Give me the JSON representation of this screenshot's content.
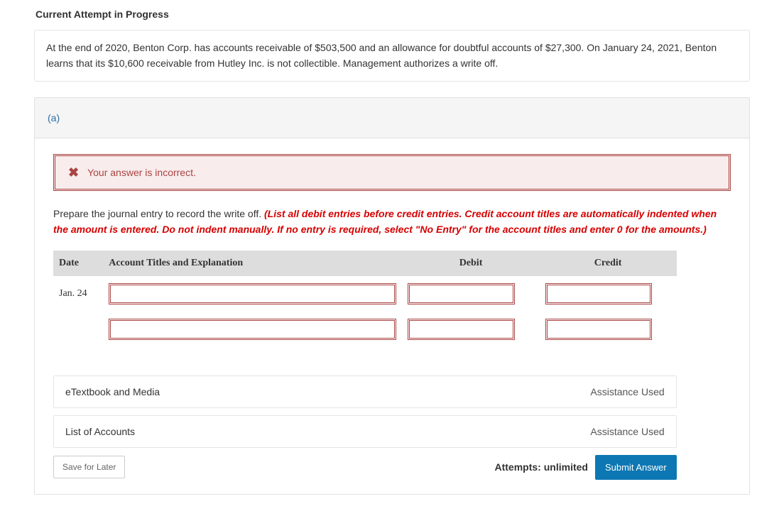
{
  "heading": "Current Attempt in Progress",
  "question_text": "At the end of 2020, Benton Corp. has accounts receivable of $503,500 and an allowance for doubtful accounts of $27,300. On January 24, 2021, Benton learns that its $10,600 receivable from Hutley Inc. is not collectible. Management authorizes a write off.",
  "part_label": "(a)",
  "alert_text": "Your answer is incorrect.",
  "instruction_plain": "Prepare the journal entry to record the write off. ",
  "instruction_red": "(List all debit entries before credit entries. Credit account titles are automatically indented when the amount is entered. Do not indent manually. If no entry is required, select \"No Entry\" for the account titles and enter 0 for the amounts.)",
  "table": {
    "headers": {
      "date": "Date",
      "acct": "Account Titles and Explanation",
      "debit": "Debit",
      "credit": "Credit"
    },
    "rows": [
      {
        "date": "Jan. 24",
        "acct": "",
        "debit": "",
        "credit": ""
      },
      {
        "date": "",
        "acct": "",
        "debit": "",
        "credit": ""
      }
    ]
  },
  "links": {
    "etext": "eTextbook and Media",
    "loa": "List of Accounts",
    "assistance": "Assistance Used"
  },
  "actions": {
    "save": "Save for Later",
    "attempts_prefix": "Attempts: ",
    "attempts_value": "unlimited",
    "submit": "Submit Answer"
  }
}
